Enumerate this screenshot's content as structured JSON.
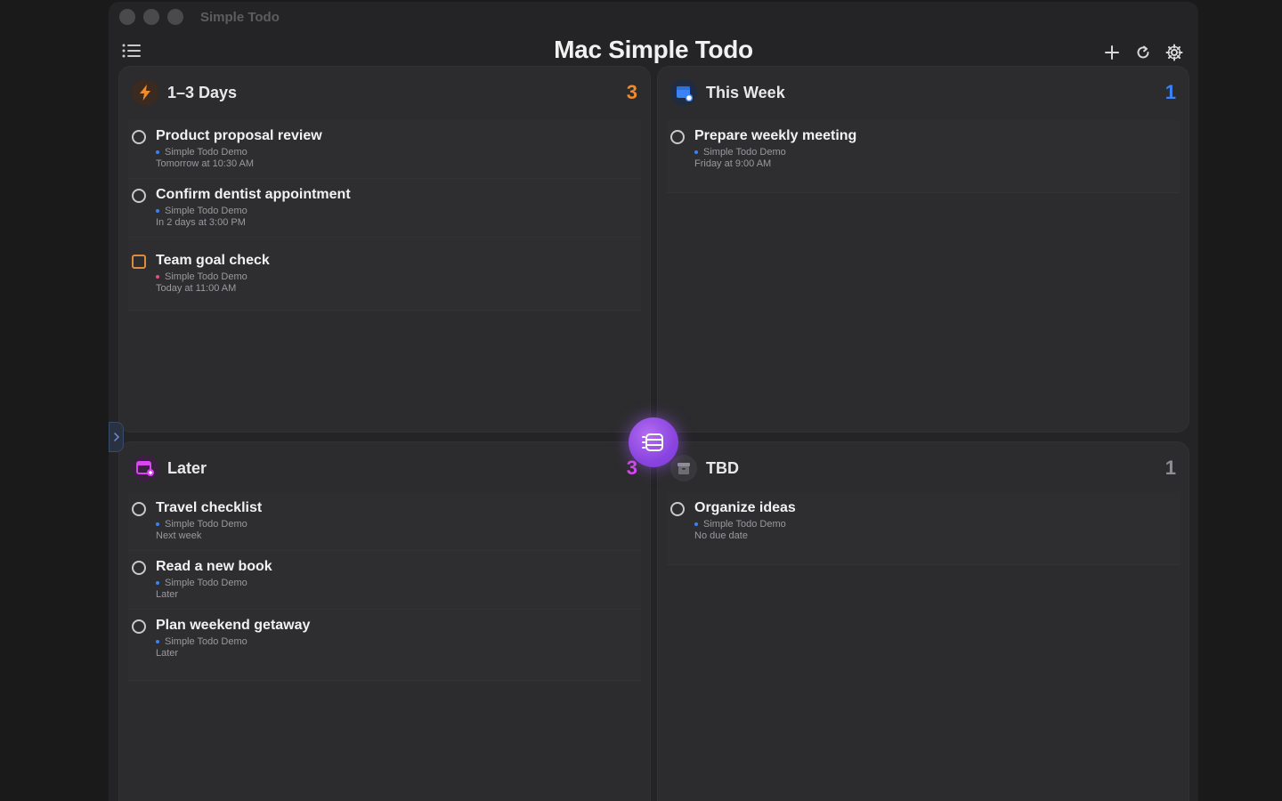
{
  "window": {
    "title": "Simple Todo"
  },
  "toolbar": {
    "app_title": "Mac Simple Todo"
  },
  "colors": {
    "accent_orange": "#f08a2c",
    "accent_blue": "#3b82f6",
    "accent_pink": "#d946ef",
    "accent_gray": "#8e8e93"
  },
  "panels": {
    "days": {
      "title": "1–3 Days",
      "count": "3",
      "icon": "bolt-icon",
      "tasks": [
        {
          "title": "Product proposal review",
          "list": "Simple Todo Demo",
          "due": "Tomorrow at 10:30 AM"
        },
        {
          "title": "Confirm dentist appointment",
          "list": "Simple Todo Demo",
          "due": "In 2 days at 3:00 PM"
        },
        {
          "title": "Team goal check",
          "list": "Simple Todo Demo",
          "due": "Today at 11:00 AM"
        }
      ]
    },
    "week": {
      "title": "This Week",
      "count": "1",
      "icon": "calendar-icon",
      "tasks": [
        {
          "title": "Prepare weekly meeting",
          "list": "Simple Todo Demo",
          "due": "Friday at 9:00 AM"
        }
      ]
    },
    "later": {
      "title": "Later",
      "count": "3",
      "icon": "calendar-plus-icon",
      "tasks": [
        {
          "title": "Travel checklist",
          "list": "Simple Todo Demo",
          "due": "Next week"
        },
        {
          "title": "Read a new book",
          "list": "Simple Todo Demo",
          "due": "Later"
        },
        {
          "title": "Plan weekend getaway",
          "list": "Simple Todo Demo",
          "due": "Later"
        }
      ]
    },
    "tbd": {
      "title": "TBD",
      "count": "1",
      "icon": "archive-icon",
      "tasks": [
        {
          "title": "Organize ideas",
          "list": "Simple Todo Demo",
          "due": "No due date"
        }
      ]
    }
  }
}
